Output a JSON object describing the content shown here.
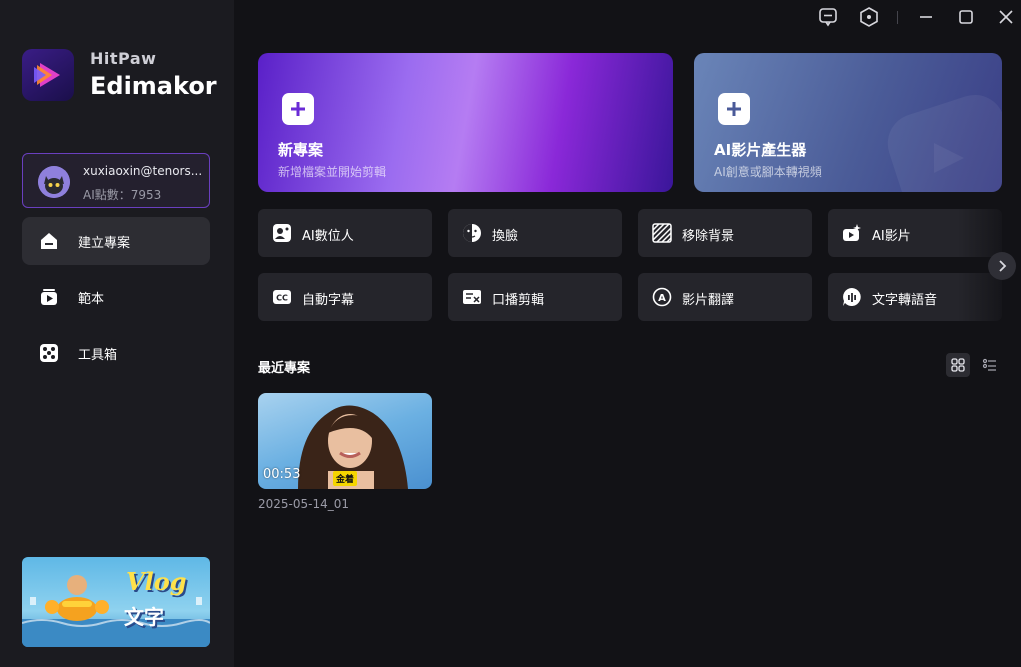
{
  "brand": {
    "line1": "HitPaw",
    "line2": "Edimakor"
  },
  "account": {
    "email": "xuxiaoxin@tenors...",
    "points": "AI點數：7953"
  },
  "nav": [
    {
      "label": "建立專案",
      "icon": "home-icon",
      "active": true
    },
    {
      "label": "範本",
      "icon": "template-icon",
      "active": false
    },
    {
      "label": "工具箱",
      "icon": "toolbox-icon",
      "active": false
    }
  ],
  "titlebar": {
    "icons": [
      "feedback-icon",
      "settings-hex-icon",
      "minimize-icon",
      "maximize-icon",
      "close-icon"
    ]
  },
  "hero": {
    "new_project": {
      "title": "新專案",
      "subtitle": "新增檔案並開始剪輯"
    },
    "ai_video": {
      "title": "AI影片產生器",
      "subtitle": "AI創意或腳本轉視頻"
    }
  },
  "tools": [
    {
      "label": "AI數位人",
      "icon": "digital-human-icon"
    },
    {
      "label": "換臉",
      "icon": "face-swap-icon"
    },
    {
      "label": "移除背景",
      "icon": "remove-bg-icon"
    },
    {
      "label": "AI影片",
      "icon": "ai-video-icon"
    },
    {
      "label": "自動字幕",
      "icon": "cc-icon"
    },
    {
      "label": "口播剪輯",
      "icon": "talk-edit-icon"
    },
    {
      "label": "影片翻譯",
      "icon": "translate-icon"
    },
    {
      "label": "文字轉語音",
      "icon": "tts-icon"
    }
  ],
  "recent": {
    "title": "最近專案",
    "items": [
      {
        "name": "2025-05-14_01",
        "duration": "00:53",
        "badge": "金着"
      }
    ]
  },
  "promo": {
    "line1": "Vlog",
    "line2": "文字"
  },
  "colors": {
    "accent": "#6a3fbf",
    "sidebar": "#1b1b20",
    "main": "#121216",
    "tile": "#25252b"
  }
}
